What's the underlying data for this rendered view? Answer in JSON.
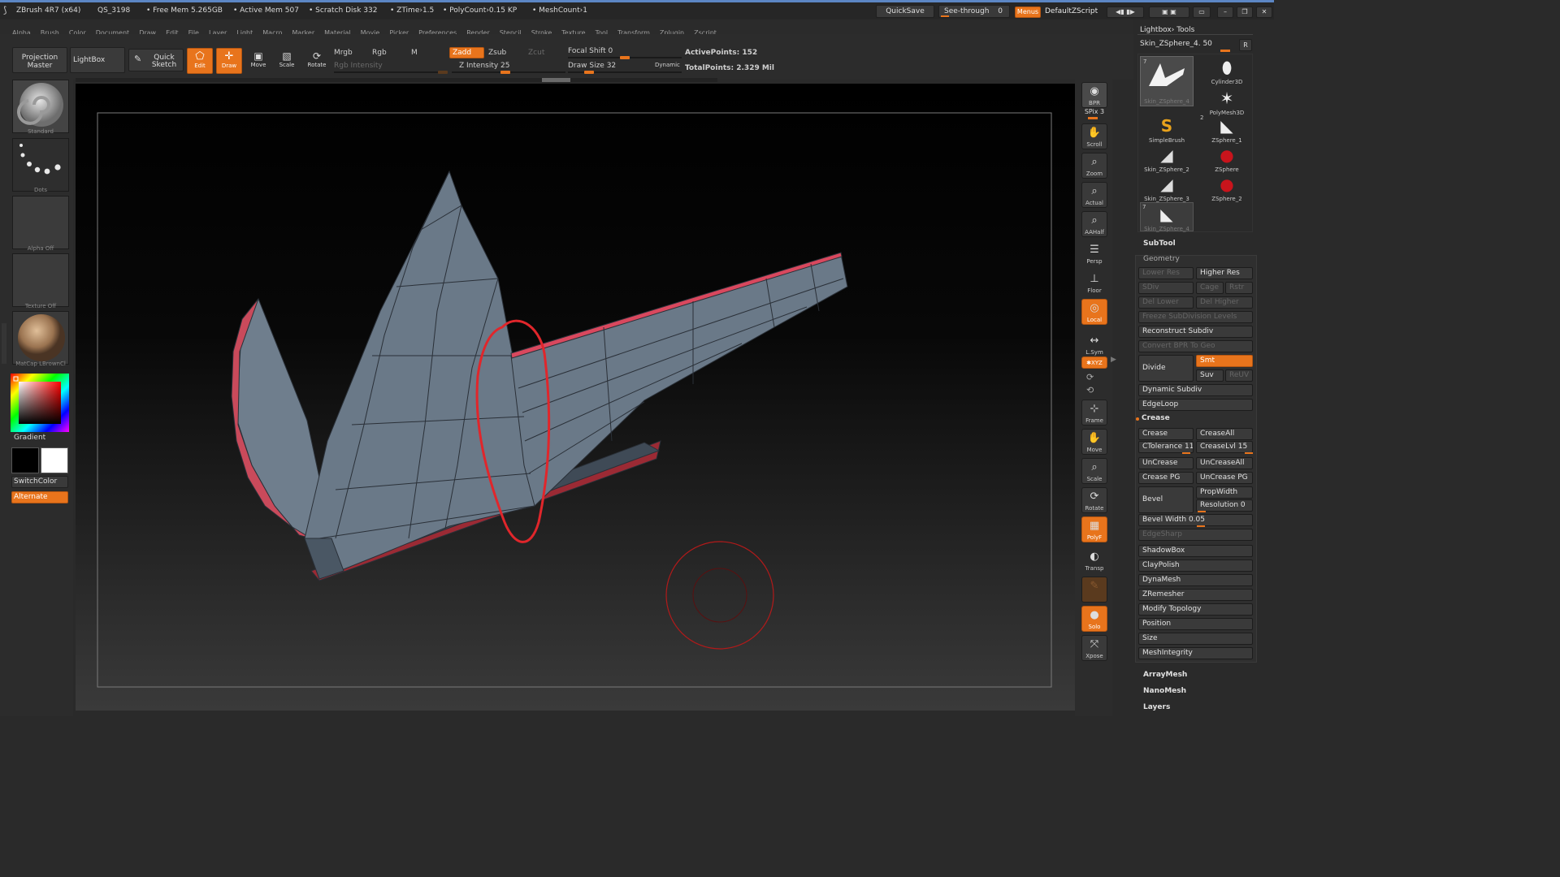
{
  "title_bar": {
    "app": "ZBrush 4R7 (x64)",
    "project": "QS_3198",
    "free_mem": "• Free Mem 5.265GB",
    "active_mem": "• Active Mem 507",
    "scratch": "• Scratch Disk 332",
    "ztime": "• ZTime›1.5",
    "polycount": "• PolyCount›0.15 KP",
    "meshcount": "• MeshCount›1",
    "quicksave": "QuickSave",
    "see_through": "See-through",
    "see_through_value": "0",
    "menus": "Menus",
    "zscript": "DefaultZScript"
  },
  "menu": [
    "Alpha",
    "Brush",
    "Color",
    "Document",
    "Draw",
    "Edit",
    "File",
    "Layer",
    "Light",
    "Macro",
    "Marker",
    "Material",
    "Movie",
    "Picker",
    "Preferences",
    "Render",
    "Stencil",
    "Stroke",
    "Texture",
    "Tool",
    "Transform",
    "Zplugin",
    "Zscript"
  ],
  "toolbar": {
    "projection_master": "Projection Master",
    "lightbox": "LightBox",
    "quick_sketch": "Quick Sketch",
    "edit": "Edit",
    "draw": "Draw",
    "move": "Move",
    "scale": "Scale",
    "rotate": "Rotate",
    "mrgb": "Mrgb",
    "rgb": "Rgb",
    "m": "M",
    "rgb_intensity": "Rgb Intensity",
    "zadd": "Zadd",
    "zsub": "Zsub",
    "zcut": "Zcut",
    "z_intensity": "Z Intensity 25",
    "focal_shift": "Focal Shift 0",
    "draw_size": "Draw Size 32",
    "dynamic": "Dynamic",
    "active_points": "ActivePoints: 152",
    "total_points": "TotalPoints: 2.329 Mil",
    "z_intensity_value": 25,
    "focal_shift_value": 0,
    "draw_size_value": 32
  },
  "left": {
    "brush": "Standard",
    "stroke": "Dots",
    "alpha": "Alpha Off",
    "texture": "Texture Off",
    "material": "MatCap LBrownCl",
    "gradient": "Gradient",
    "switch_color": "SwitchColor",
    "alternate": "Alternate"
  },
  "nav": [
    {
      "id": "bpr",
      "label": "BPR"
    },
    {
      "id": "spix",
      "label": "SPix 3"
    },
    {
      "id": "scroll",
      "label": "Scroll"
    },
    {
      "id": "zoom",
      "label": "Zoom"
    },
    {
      "id": "actual",
      "label": "Actual"
    },
    {
      "id": "aahalf",
      "label": "AAHalf"
    },
    {
      "id": "persp",
      "label": "Persp"
    },
    {
      "id": "floor",
      "label": "Floor"
    },
    {
      "id": "local",
      "label": "Local"
    },
    {
      "id": "lsym",
      "label": "L.Sym"
    },
    {
      "id": "xyz",
      "label": "✱XYZ"
    },
    {
      "id": "frame",
      "label": "Frame"
    },
    {
      "id": "move",
      "label": "Move"
    },
    {
      "id": "scale",
      "label": "Scale"
    },
    {
      "id": "rotate",
      "label": "Rotate"
    },
    {
      "id": "polyf",
      "label": "PolyF"
    },
    {
      "id": "transp",
      "label": "Transp"
    },
    {
      "id": "ghost",
      "label": "Ghost"
    },
    {
      "id": "solo",
      "label": "Solo"
    },
    {
      "id": "xpose",
      "label": "Xpose"
    }
  ],
  "right": {
    "header": "Lightbox› Tools",
    "current_tool": "Skin_ZSphere_4. 50",
    "r_button": "R",
    "tools": [
      {
        "name": "Skin_ZSphere_4",
        "badge": "7"
      },
      {
        "name": "Cylinder3D",
        "badge": ""
      },
      {
        "name": "",
        "badge": ""
      },
      {
        "name": "PolyMesh3D",
        "badge": ""
      },
      {
        "name": "SimpleBrush",
        "badge": ""
      },
      {
        "name": "ZSphere_1",
        "badge": "2"
      },
      {
        "name": "Skin_ZSphere_2",
        "badge": ""
      },
      {
        "name": "ZSphere",
        "badge": ""
      },
      {
        "name": "Skin_ZSphere_3",
        "badge": ""
      },
      {
        "name": "ZSphere_2",
        "badge": ""
      },
      {
        "name": "Skin_ZSphere_4",
        "badge": "7"
      }
    ],
    "subtool": "SubTool",
    "geometry": "Geometry",
    "lower_res": "Lower Res",
    "higher_res": "Higher Res",
    "sdiv": "SDiv",
    "cage": "Cage",
    "rstr": "Rstr",
    "del_lower": "Del Lower",
    "del_higher": "Del Higher",
    "freeze": "Freeze SubDivision Levels",
    "reconstruct": "Reconstruct Subdiv",
    "convert_bpr": "Convert BPR To Geo",
    "divide": "Divide",
    "smt": "Smt",
    "suv": "Suv",
    "reuv": "ReUV",
    "dynamic_subdiv": "Dynamic Subdiv",
    "edgeloop": "EdgeLoop",
    "crease_section": "Crease",
    "crease": "Crease",
    "crease_all": "CreaseAll",
    "ctolerance": "CTolerance 11 ",
    "crease_lvl": "CreaseLvl 15",
    "uncrease": "UnCrease",
    "uncrease_all": "UnCreaseAll",
    "crease_pg": "Crease PG",
    "uncrease_pg": "UnCrease PG",
    "bevel": "Bevel",
    "prop_width": "PropWidth",
    "resolution": "Resolution 0",
    "bevel_width": "Bevel Width 0.05",
    "edge_sharp": "EdgeSharp",
    "shadowbox": "ShadowBox",
    "claypolish": "ClayPolish",
    "dynamesh": "DynaMesh",
    "zremesher": "ZRemesher",
    "modify_topology": "Modify Topology",
    "position": "Position",
    "size": "Size",
    "meshintegrity": "MeshIntegrity",
    "arraymesh": "ArrayMesh",
    "nanomesh": "NanoMesh",
    "layers": "Layers"
  },
  "colors": {
    "accent": "#e8741c",
    "mesh": "#5d6b7a",
    "crease_edge": "#d9485e",
    "annotation": "#e0262b",
    "title_line": "#5c86c4"
  }
}
